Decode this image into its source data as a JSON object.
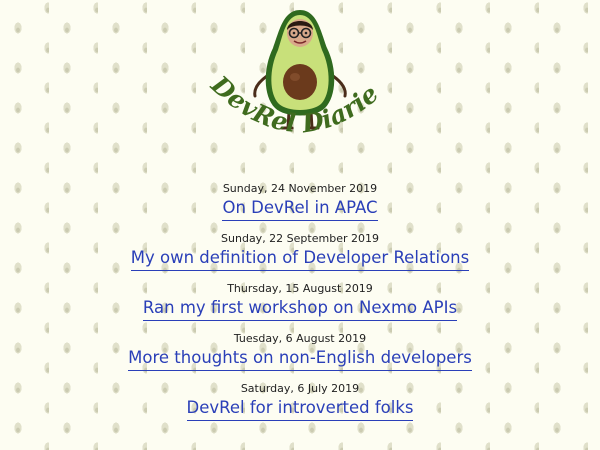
{
  "header": {
    "logo_text": "DevRel Diaries"
  },
  "posts": [
    {
      "date": "Sunday, 24 November 2019",
      "title": "On DevRel in APAC"
    },
    {
      "date": "Sunday, 22 September 2019",
      "title": "My own definition of Developer Relations"
    },
    {
      "date": "Thursday, 15 August 2019",
      "title": "Ran my first workshop on Nexmo APIs"
    },
    {
      "date": "Tuesday, 6 August 2019",
      "title": "More thoughts on non-English developers"
    },
    {
      "date": "Saturday, 6 July 2019",
      "title": "DevRel for introverted folks"
    }
  ],
  "colors": {
    "background": "#fdfdf2",
    "link": "#2a3fb8",
    "logo_green": "#3f6b1e",
    "avocado_flesh": "#c8e07a",
    "avocado_skin": "#2f6a1f",
    "pit": "#6b3a1c"
  }
}
